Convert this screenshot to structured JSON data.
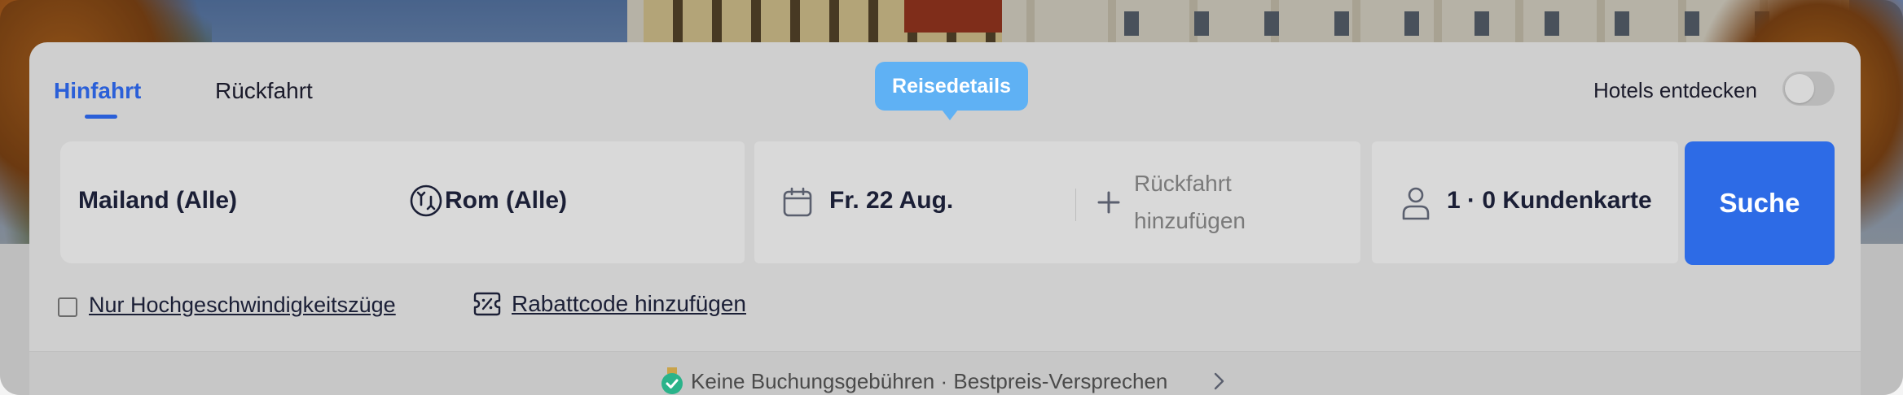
{
  "tabs": {
    "outbound_label": "Hinfahrt",
    "return_label": "Rückfahrt"
  },
  "tooltip": {
    "text": "Reisedetails"
  },
  "hotels_toggle": {
    "label": "Hotels entdecken",
    "state": "off"
  },
  "route": {
    "from": "Mailand (Alle)",
    "to": "Rom (Alle)"
  },
  "dates": {
    "outbound": "Fr. 22 Aug.",
    "return_line1": "Rückfahrt",
    "return_line2": "hinzufügen"
  },
  "passengers": {
    "label": "1 · 0 Kundenkarte"
  },
  "search_button": {
    "label": "Suche"
  },
  "options": {
    "highspeed_label": "Nur Hochgeschwindigkeitszüge",
    "highspeed_checked": false,
    "discount_label": "Rabattcode hinzufügen"
  },
  "footer": {
    "text": "Keine Buchungsgebühren · Bestpreis-Versprechen"
  },
  "colors": {
    "accent": "#2d6be6",
    "tooltip": "#5fb1f4",
    "active_tab": "#2a5fd8"
  },
  "icons": [
    "swap-icon",
    "calendar-icon",
    "plus-icon",
    "user-icon",
    "voucher-icon",
    "badge-icon",
    "chevron-right-icon"
  ]
}
